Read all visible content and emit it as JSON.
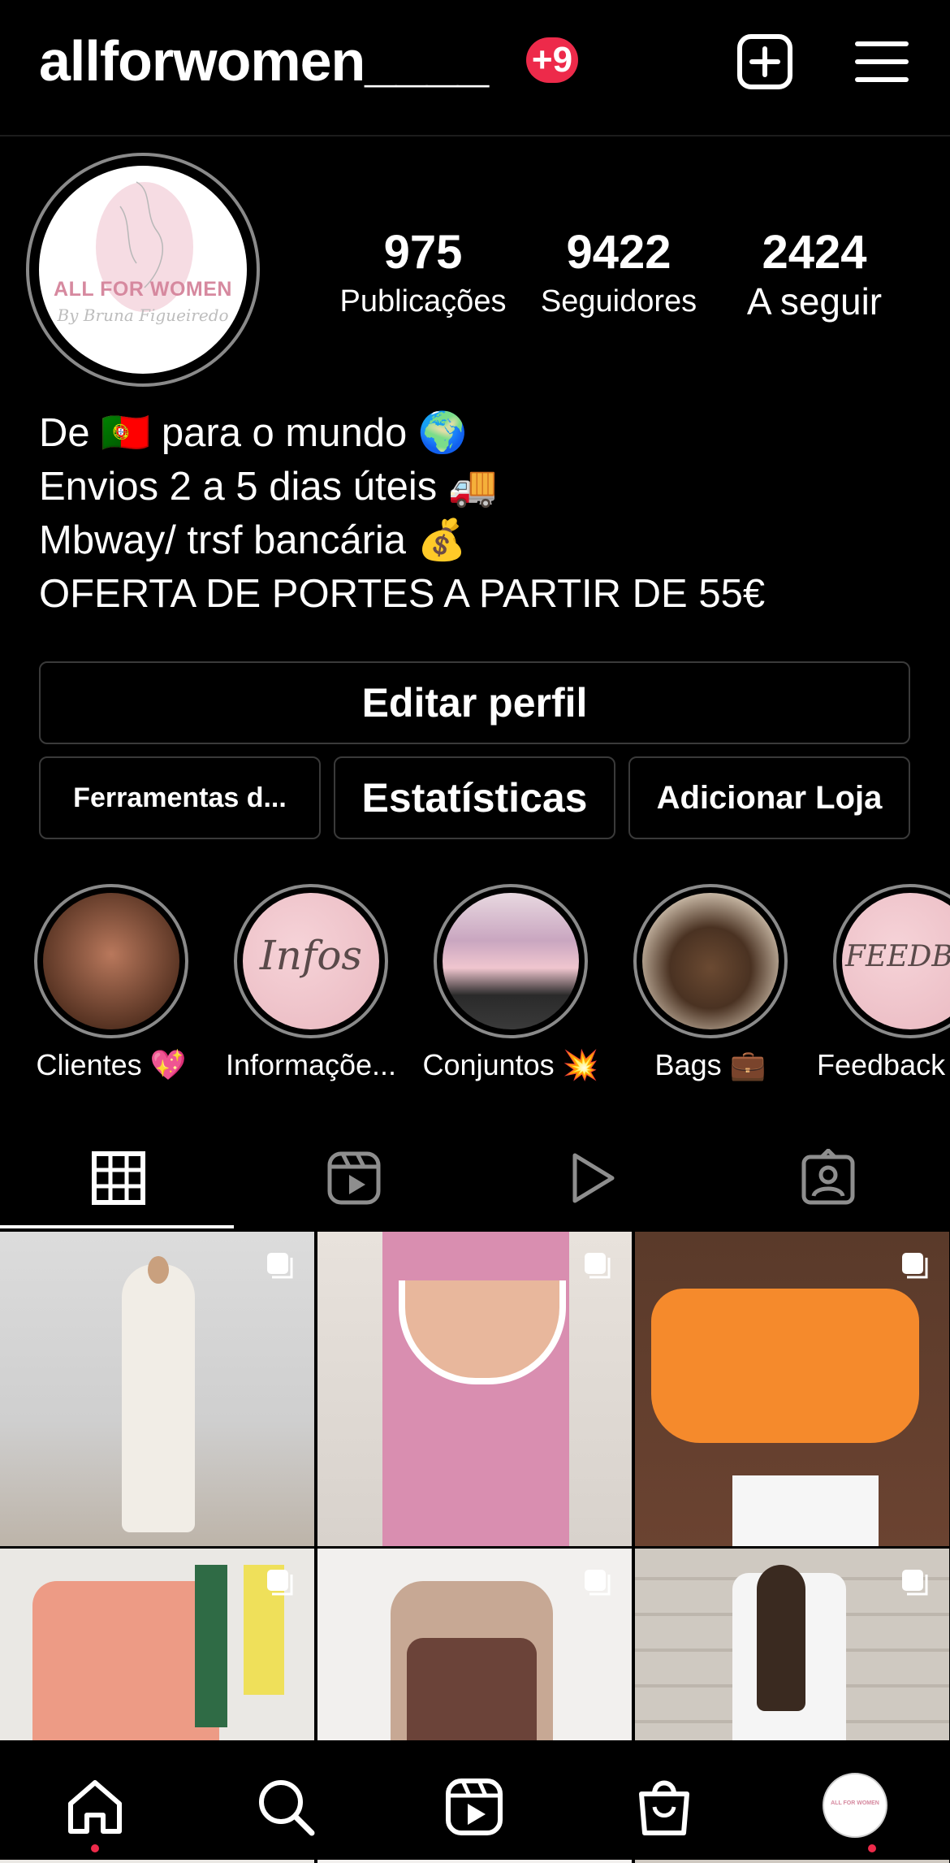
{
  "header": {
    "username": "allforwomen____",
    "notification_badge": "+9"
  },
  "profile": {
    "avatar_brand": "ALL FOR WOMEN",
    "avatar_sub": "By Bruna Figueiredo",
    "stats": [
      {
        "value": "975",
        "label": "Publicações"
      },
      {
        "value": "9422",
        "label": "Seguidores"
      },
      {
        "value": "2424",
        "label": "A seguir"
      }
    ],
    "bio": [
      "De 🇵🇹 para o mundo 🌍",
      "Envios 2 a 5 dias úteis 🚚",
      "Mbway/ trsf bancária 💰",
      "OFERTA DE PORTES A PARTIR DE 55€"
    ]
  },
  "buttons": {
    "edit_profile": "Editar perfil",
    "tools": "Ferramentas d...",
    "stats": "Estatísticas",
    "add_shop": "Adicionar Loja"
  },
  "highlights": [
    {
      "label": "Clientes 💖"
    },
    {
      "label": "Informaçõe...",
      "cover_text": "Infos"
    },
    {
      "label": "Conjuntos 💥"
    },
    {
      "label": "Bags 💼"
    },
    {
      "label": "Feedback",
      "cover_text": "FEEDBACK"
    }
  ],
  "tabs": [
    {
      "icon": "grid-icon",
      "active": true
    },
    {
      "icon": "reels-icon",
      "active": false
    },
    {
      "icon": "video-play-icon",
      "active": false
    },
    {
      "icon": "tagged-icon",
      "active": false
    }
  ],
  "posts": [
    {
      "description": "white outfit with cape",
      "multi": true
    },
    {
      "description": "pink tank bodysuit",
      "multi": true
    },
    {
      "description": "orange tie crop top",
      "multi": true
    },
    {
      "description": "coral jumpsuit",
      "multi": true
    },
    {
      "description": "brown halter bodysuit",
      "multi": true
    },
    {
      "description": "white blazer",
      "multi": true
    }
  ],
  "bottom_nav": [
    {
      "icon": "home-icon",
      "dot": true
    },
    {
      "icon": "search-icon",
      "dot": false
    },
    {
      "icon": "reels-icon",
      "dot": false
    },
    {
      "icon": "shop-icon",
      "dot": false
    },
    {
      "icon": "profile-avatar",
      "dot": true
    }
  ],
  "colors": {
    "background": "#000000",
    "badge": "#ed2a4a",
    "button_border": "#3a3a3a",
    "text": "#ffffff"
  }
}
